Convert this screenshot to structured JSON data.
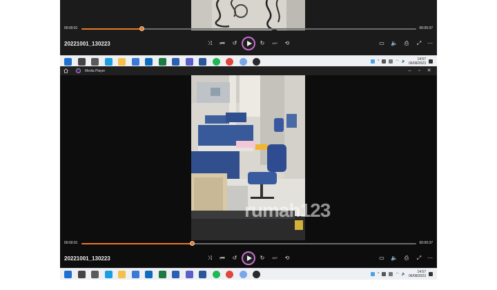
{
  "top_player": {
    "time_elapsed": "00:00:01",
    "time_total": "00:00:37",
    "progress": 0.18,
    "file_name": "20221001_130223"
  },
  "top_taskbar": {
    "clock_time": "14:57",
    "clock_date": "06/08/2023"
  },
  "main_player": {
    "window_title": "Media Player",
    "time_elapsed": "00:00:01",
    "time_total": "00:00:37",
    "progress": 0.33,
    "file_name": "20221001_130223",
    "watermark": "rumah123"
  },
  "bottom_taskbar": {
    "clock_time": "14:57",
    "clock_date": "06/08/2023"
  },
  "colors": {
    "accent": "#e8782a",
    "play_ring": "#c66fd0",
    "player_bg": "#0d0d0d"
  },
  "taskbar_icons": [
    "windows-start",
    "search",
    "task-view",
    "edge",
    "file-explorer",
    "store",
    "outlook",
    "excel",
    "word-doc",
    "teams",
    "word",
    "spotify",
    "chrome",
    "browser",
    "media-player"
  ]
}
